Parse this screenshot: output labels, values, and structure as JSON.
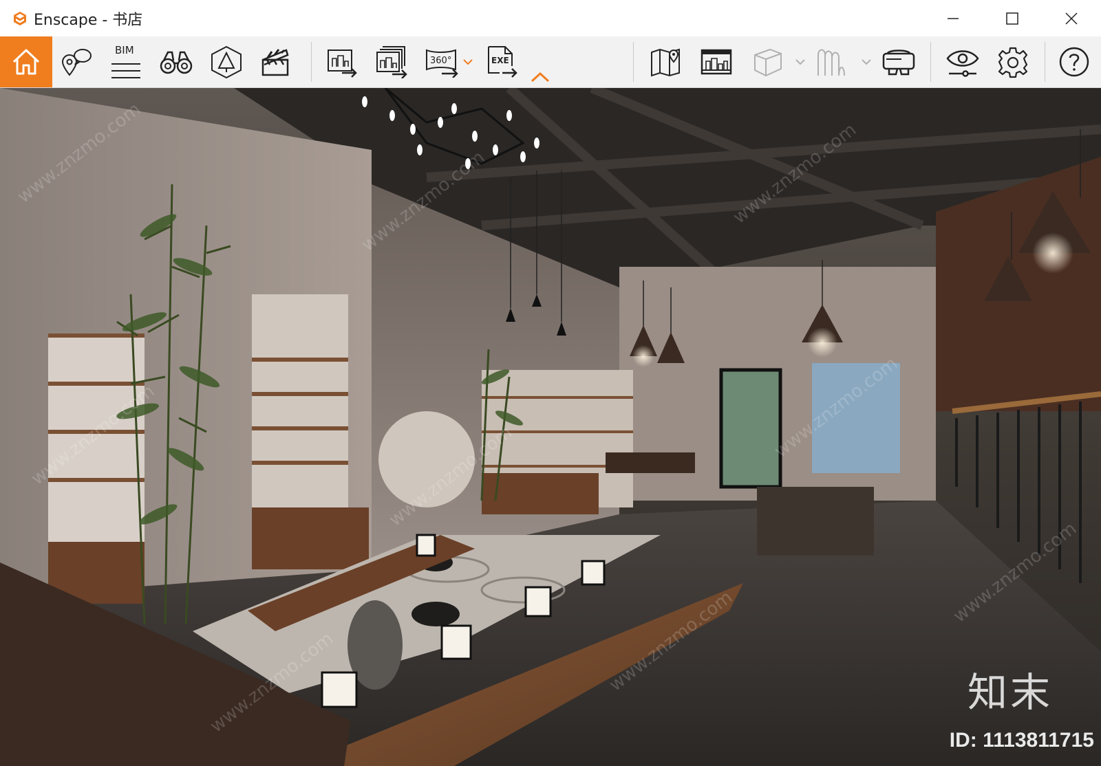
{
  "window": {
    "title": "Enscape - 书店",
    "controls": [
      "minimize-icon",
      "maximize-icon",
      "close-icon"
    ]
  },
  "toolbar": {
    "home_icon": "home-icon",
    "bim_label": "BIM",
    "pano_label": "360°",
    "exe_label": "EXE",
    "accent": "#f07d1e",
    "icons": [
      "home-icon",
      "view-location-icon",
      "bim-icon",
      "binoculars-icon",
      "perspective-icon",
      "clapperboard-icon",
      "export-image-icon",
      "batch-export-icon",
      "export-360-icon",
      "export-exe-icon",
      "collapse-chevron-icon",
      "map-icon",
      "asset-library-icon",
      "cube-icon",
      "atmosphere-icon",
      "vr-headset-icon",
      "visual-settings-icon",
      "gear-icon",
      "help-icon"
    ]
  },
  "viewport": {
    "watermark_logo": "知末",
    "watermark_id": "ID: 1113811715",
    "watermark_text": "www.znzmo.com"
  }
}
